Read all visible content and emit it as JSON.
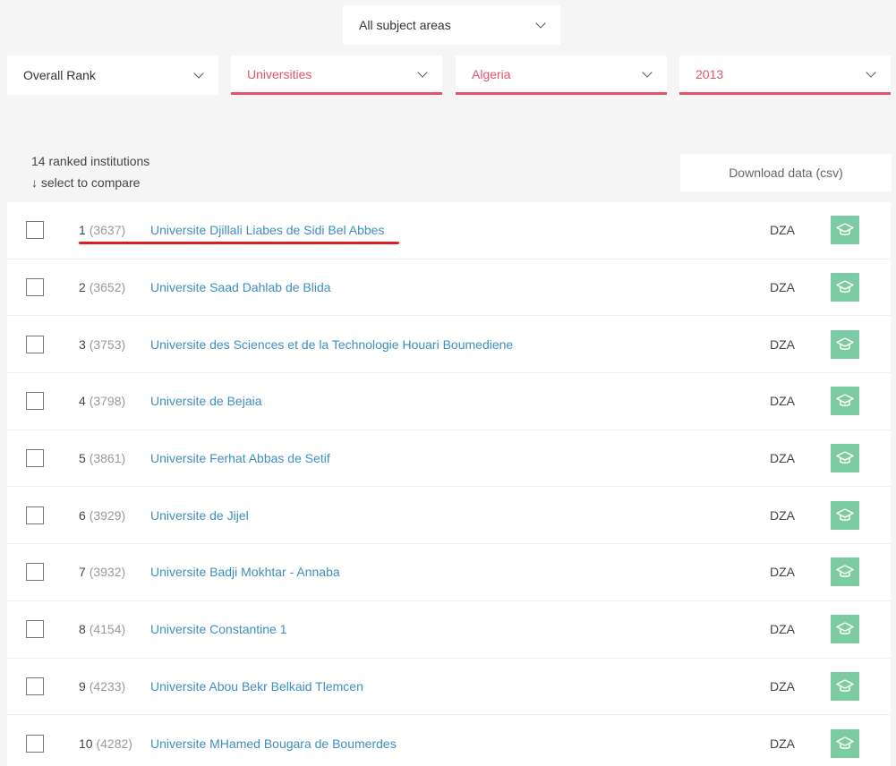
{
  "filters": {
    "subject": "All subject areas",
    "rank_by": "Overall Rank",
    "type": "Universities",
    "country": "Algeria",
    "year": "2013"
  },
  "summary": {
    "count_text": "14 ranked institutions",
    "compare_text": "↓ select to compare"
  },
  "download_label": "Download data (csv)",
  "colors": {
    "accent": "#e5536a",
    "link": "#3d8fc1",
    "badge": "#7ccba3"
  },
  "rows": [
    {
      "rank": "1",
      "world": "(3637)",
      "name": "Universite Djillali Liabes de Sidi Bel Abbes",
      "code": "DZA"
    },
    {
      "rank": "2",
      "world": "(3652)",
      "name": "Universite Saad Dahlab de Blida",
      "code": "DZA"
    },
    {
      "rank": "3",
      "world": "(3753)",
      "name": "Universite des Sciences et de la Technologie Houari Boumediene",
      "code": "DZA"
    },
    {
      "rank": "4",
      "world": "(3798)",
      "name": "Universite de Bejaia",
      "code": "DZA"
    },
    {
      "rank": "5",
      "world": "(3861)",
      "name": "Universite Ferhat Abbas de Setif",
      "code": "DZA"
    },
    {
      "rank": "6",
      "world": "(3929)",
      "name": "Universite de Jijel",
      "code": "DZA"
    },
    {
      "rank": "7",
      "world": "(3932)",
      "name": "Universite Badji Mokhtar - Annaba",
      "code": "DZA"
    },
    {
      "rank": "8",
      "world": "(4154)",
      "name": "Universite Constantine 1",
      "code": "DZA"
    },
    {
      "rank": "9",
      "world": "(4233)",
      "name": "Universite Abou Bekr Belkaid Tlemcen",
      "code": "DZA"
    },
    {
      "rank": "10",
      "world": "(4282)",
      "name": "Universite MHamed Bougara de Boumerdes",
      "code": "DZA"
    }
  ]
}
